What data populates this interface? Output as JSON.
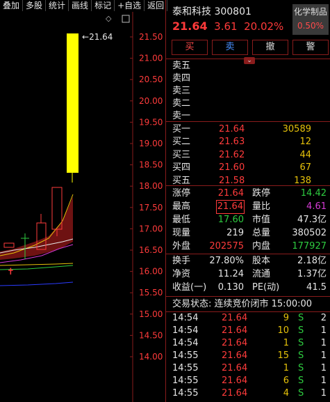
{
  "toolbar": [
    "叠加",
    "多股",
    "统计",
    "画线",
    "标记",
    "+自选",
    "返回"
  ],
  "chart": {
    "axis_labels": [
      "21.50",
      "21.00",
      "20.50",
      "20.00",
      "19.50",
      "19.00",
      "18.50",
      "18.00",
      "17.50",
      "17.00",
      "16.50",
      "16.00",
      "15.50",
      "15.00",
      "14.50",
      "14.00"
    ],
    "high_label": "21.64"
  },
  "stock": {
    "name": "泰和科技",
    "code": "300801",
    "price": "21.64",
    "change": "3.61",
    "pct": "20.02%"
  },
  "sector": {
    "name": "化学制品",
    "pct": "0.50%"
  },
  "buttons": {
    "buy": "买",
    "sell": "卖",
    "cancel": "撤",
    "alert": "警"
  },
  "asks": [
    {
      "label": "卖五",
      "price": "",
      "vol": ""
    },
    {
      "label": "卖四",
      "price": "",
      "vol": ""
    },
    {
      "label": "卖三",
      "price": "",
      "vol": ""
    },
    {
      "label": "卖二",
      "price": "",
      "vol": ""
    },
    {
      "label": "卖一",
      "price": "",
      "vol": ""
    }
  ],
  "bids": [
    {
      "label": "买一",
      "price": "21.64",
      "vol": "30589"
    },
    {
      "label": "买二",
      "price": "21.63",
      "vol": "12"
    },
    {
      "label": "买三",
      "price": "21.62",
      "vol": "44"
    },
    {
      "label": "买四",
      "price": "21.60",
      "vol": "67"
    },
    {
      "label": "买五",
      "price": "21.58",
      "vol": "138"
    }
  ],
  "stats": [
    {
      "l1": "涨停",
      "v1": "21.64",
      "c1": "r",
      "l2": "跌停",
      "v2": "14.42",
      "c2": "g"
    },
    {
      "l1": "最高",
      "v1": "21.64",
      "c1": "r boxed",
      "l2": "量比",
      "v2": "4.61",
      "c2": "m"
    },
    {
      "l1": "最低",
      "v1": "17.60",
      "c1": "g",
      "l2": "市值",
      "v2": "47.3亿",
      "c2": "w"
    },
    {
      "l1": "现量",
      "v1": "219",
      "c1": "w",
      "l2": "总量",
      "v2": "380502",
      "c2": "w"
    },
    {
      "l1": "外盘",
      "v1": "202575",
      "c1": "r",
      "l2": "内盘",
      "v2": "177927",
      "c2": "g"
    }
  ],
  "stats2": [
    {
      "l1": "换手",
      "v1": "27.80%",
      "l2": "股本",
      "v2": "2.18亿"
    },
    {
      "l1": "净资",
      "v1": "11.24",
      "l2": "流通",
      "v2": "1.37亿"
    },
    {
      "l1": "收益(一)",
      "v1": "0.130",
      "l2": "PE(动)",
      "v2": "41.5"
    }
  ],
  "trade_status": "交易状态: 连续竞价闭市 15:00:00",
  "ticks": [
    {
      "time": "14:54",
      "price": "21.64",
      "vol": "9",
      "dir": "S",
      "n": "2"
    },
    {
      "time": "14:54",
      "price": "21.64",
      "vol": "10",
      "dir": "S",
      "n": "1"
    },
    {
      "time": "14:54",
      "price": "21.64",
      "vol": "1",
      "dir": "S",
      "n": "1"
    },
    {
      "time": "14:55",
      "price": "21.64",
      "vol": "15",
      "dir": "S",
      "n": "1"
    },
    {
      "time": "14:55",
      "price": "21.64",
      "vol": "1",
      "dir": "S",
      "n": "1"
    },
    {
      "time": "14:55",
      "price": "21.64",
      "vol": "6",
      "dir": "S",
      "n": "1"
    },
    {
      "time": "14:55",
      "price": "21.64",
      "vol": "4",
      "dir": "S",
      "n": "1"
    }
  ],
  "colors": {
    "up": "#ff3b3b",
    "down": "#2ecc40",
    "bg": "#000000",
    "frame": "#8a1c1c"
  }
}
